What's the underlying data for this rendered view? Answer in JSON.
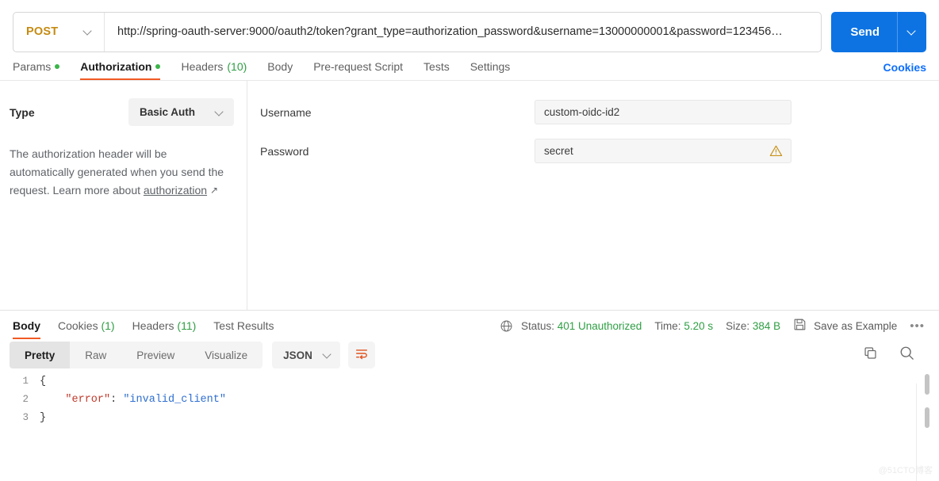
{
  "request": {
    "method": "POST",
    "url": "http://spring-oauth-server:9000/oauth2/token?grant_type=authorization_password&username=13000000001&password=123456…",
    "send_label": "Send"
  },
  "request_tabs": [
    {
      "label": "Params",
      "dot": true,
      "active": false
    },
    {
      "label": "Authorization",
      "dot": true,
      "active": true
    },
    {
      "label": "Headers",
      "count": "(10)",
      "active": false
    },
    {
      "label": "Body",
      "active": false
    },
    {
      "label": "Pre-request Script",
      "active": false
    },
    {
      "label": "Tests",
      "active": false
    },
    {
      "label": "Settings",
      "active": false
    }
  ],
  "cookies_link": "Cookies",
  "authorization": {
    "type_label": "Type",
    "type_value": "Basic Auth",
    "help_text": "The authorization header will be automatically generated when you send the request. Learn more about ",
    "help_link": "authorization",
    "fields": [
      {
        "label": "Username",
        "value": "custom-oidc-id2",
        "warn": false
      },
      {
        "label": "Password",
        "value": "secret",
        "warn": true
      }
    ]
  },
  "response_tabs": [
    {
      "label": "Body",
      "active": true
    },
    {
      "label": "Cookies",
      "count": "(1)",
      "active": false
    },
    {
      "label": "Headers",
      "count": "(11)",
      "active": false
    },
    {
      "label": "Test Results",
      "active": false
    }
  ],
  "response_meta": {
    "status_label": "Status:",
    "status_value": "401 Unauthorized",
    "time_label": "Time:",
    "time_value": "5.20 s",
    "size_label": "Size:",
    "size_value": "384 B",
    "save_as_example": "Save as Example",
    "more": "⁝"
  },
  "response_toolbar": {
    "views": [
      {
        "label": "Pretty",
        "active": true
      },
      {
        "label": "Raw",
        "active": false
      },
      {
        "label": "Preview",
        "active": false
      },
      {
        "label": "Visualize",
        "active": false
      }
    ],
    "format": "JSON"
  },
  "response_body": {
    "lines": [
      {
        "n": "1",
        "open": "{"
      },
      {
        "n": "2",
        "key": "\"error\"",
        "colon": ": ",
        "value": "\"invalid_client\""
      },
      {
        "n": "3",
        "open": "}"
      }
    ]
  },
  "watermark": "@51CTO博客",
  "colors": {
    "accent_orange": "#f15a24",
    "send_blue": "#0d73e3",
    "method_amber": "#c58b12",
    "status_green": "#2f9e44",
    "link_blue": "#0d6efd",
    "warn_amber": "#c8921a"
  }
}
